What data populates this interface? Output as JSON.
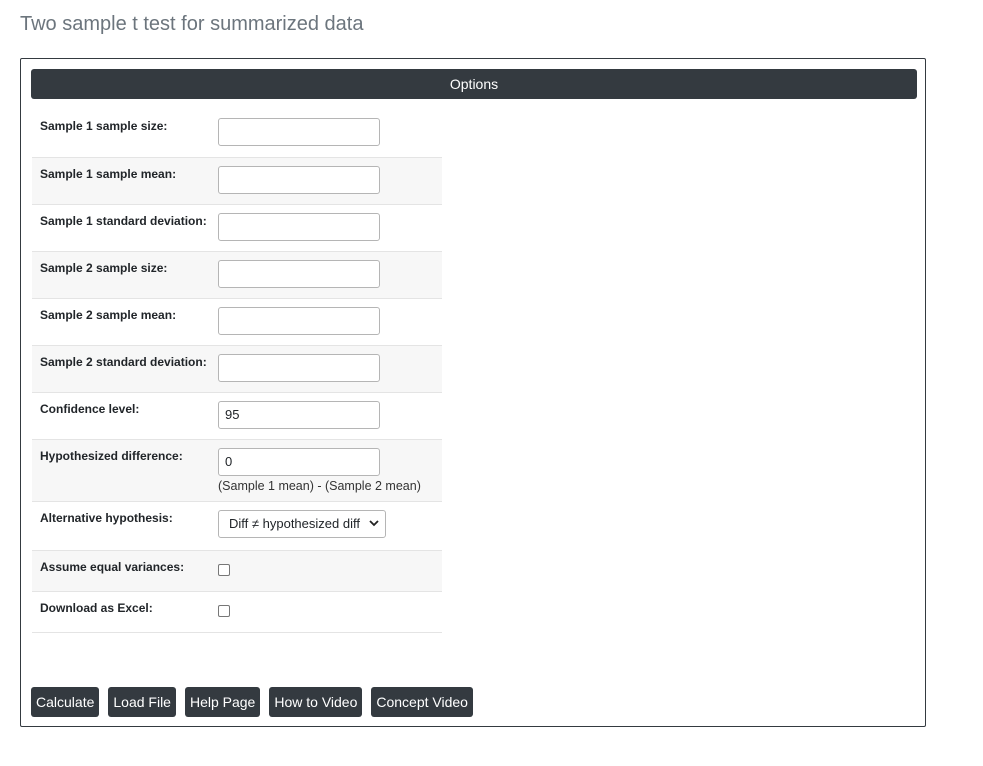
{
  "page": {
    "title": "Two sample t test for summarized data"
  },
  "panel": {
    "header": "Options"
  },
  "fields": {
    "n1": {
      "label": "Sample 1 sample size:",
      "value": ""
    },
    "mean1": {
      "label": "Sample 1 sample mean:",
      "value": ""
    },
    "sd1": {
      "label": "Sample 1 standard deviation:",
      "value": ""
    },
    "n2": {
      "label": "Sample 2 sample size:",
      "value": ""
    },
    "mean2": {
      "label": "Sample 2 sample mean:",
      "value": ""
    },
    "sd2": {
      "label": "Sample 2 standard deviation:",
      "value": ""
    },
    "confidence": {
      "label": "Confidence level:",
      "value": "95"
    },
    "hypdiff": {
      "label": "Hypothesized difference:",
      "value": "0",
      "hint": "(Sample 1 mean) - (Sample 2 mean)"
    },
    "alternative": {
      "label": "Alternative hypothesis:",
      "selected": "Diff ≠ hypothesized diff"
    },
    "equal_var": {
      "label": "Assume equal variances:",
      "checked": false
    },
    "excel": {
      "label": "Download as Excel:",
      "checked": false
    }
  },
  "buttons": {
    "calculate": "Calculate",
    "load_file": "Load File",
    "help_page": "Help Page",
    "how_to_video": "How to Video",
    "concept_video": "Concept Video"
  },
  "icons": {
    "select_arrow": "chevron-down-icon"
  }
}
